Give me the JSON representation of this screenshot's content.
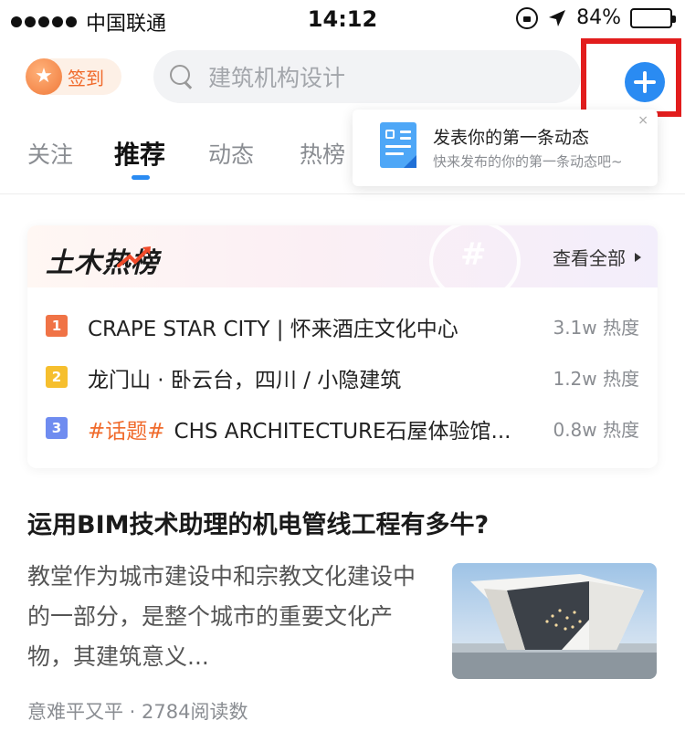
{
  "status_bar": {
    "carrier": "中国联通",
    "time": "14:12",
    "battery": "84%"
  },
  "header": {
    "checkin_label": "签到",
    "search_placeholder": "建筑机构设计"
  },
  "tabs": [
    {
      "label": "关注",
      "active": false
    },
    {
      "label": "推荐",
      "active": true
    },
    {
      "label": "动态",
      "active": false
    },
    {
      "label": "热榜",
      "active": false
    }
  ],
  "popover": {
    "title": "发表你的第一条动态",
    "subtitle": "快来发布的你的第一条动态吧~",
    "close": "×"
  },
  "hot_list": {
    "title": "土木热榜",
    "view_all": "查看全部",
    "items": [
      {
        "rank": "1",
        "tag": "",
        "text": "CRAPE STAR CITY | 怀来酒庄文化中心",
        "score": "3.1w 热度",
        "color": "#f07346"
      },
      {
        "rank": "2",
        "tag": "",
        "text": "龙门山 · 卧云台，四川 / 小隐建筑",
        "score": "1.2w 热度",
        "color": "#f6bf2e"
      },
      {
        "rank": "3",
        "tag": "#话题#",
        "text": "CHS ARCHITECTURE石屋体验馆...",
        "score": "0.8w 热度",
        "color": "#6f8cf0"
      }
    ]
  },
  "article": {
    "title": "运用BIM技术助理的机电管线工程有多牛?",
    "excerpt": "教堂作为城市建设中和宗教文化建设中的一部分，是整个城市的重要文化产物，其建筑意义...",
    "meta": "意难平又平 · 2784阅读数"
  },
  "colors": {
    "accent": "#2a8bf2",
    "highlight_box": "#e21d1d",
    "checkin": "#f06a2b"
  }
}
